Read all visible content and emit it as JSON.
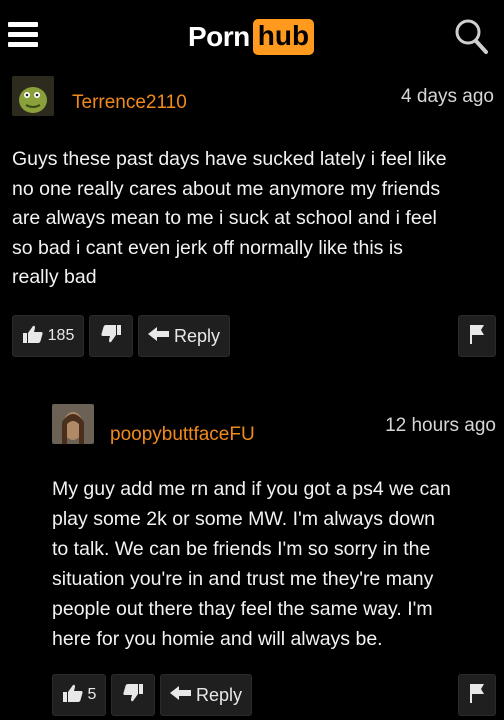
{
  "header": {
    "logo_part1": "Porn",
    "logo_part2": "hub",
    "menu_icon": "hamburger-menu-icon",
    "search_icon": "search-icon",
    "accent_color": "#ff9a1f"
  },
  "comments": [
    {
      "username": "Terrence2110",
      "timestamp": "4 days ago",
      "lines": [
        "Guys these past days have sucked lately i feel like",
        "no one really cares about me anymore my friends",
        "are always mean to me i suck at school and i feel",
        "so bad i cant even jerk off normally like this is",
        "really bad"
      ],
      "likes": "185",
      "reply_label": "Reply"
    },
    {
      "username": "poopybuttfaceFU",
      "timestamp": "12 hours ago",
      "lines": [
        "My guy add me rn and if you got a ps4 we can",
        "play some 2k or some MW. I'm always down",
        "to talk. We can be friends I'm so sorry in the",
        "situation you're in and trust me they're many",
        "people out there thay feel the same way. I'm",
        "here for you homie and will always be."
      ],
      "likes": "5",
      "reply_label": "Reply"
    }
  ]
}
